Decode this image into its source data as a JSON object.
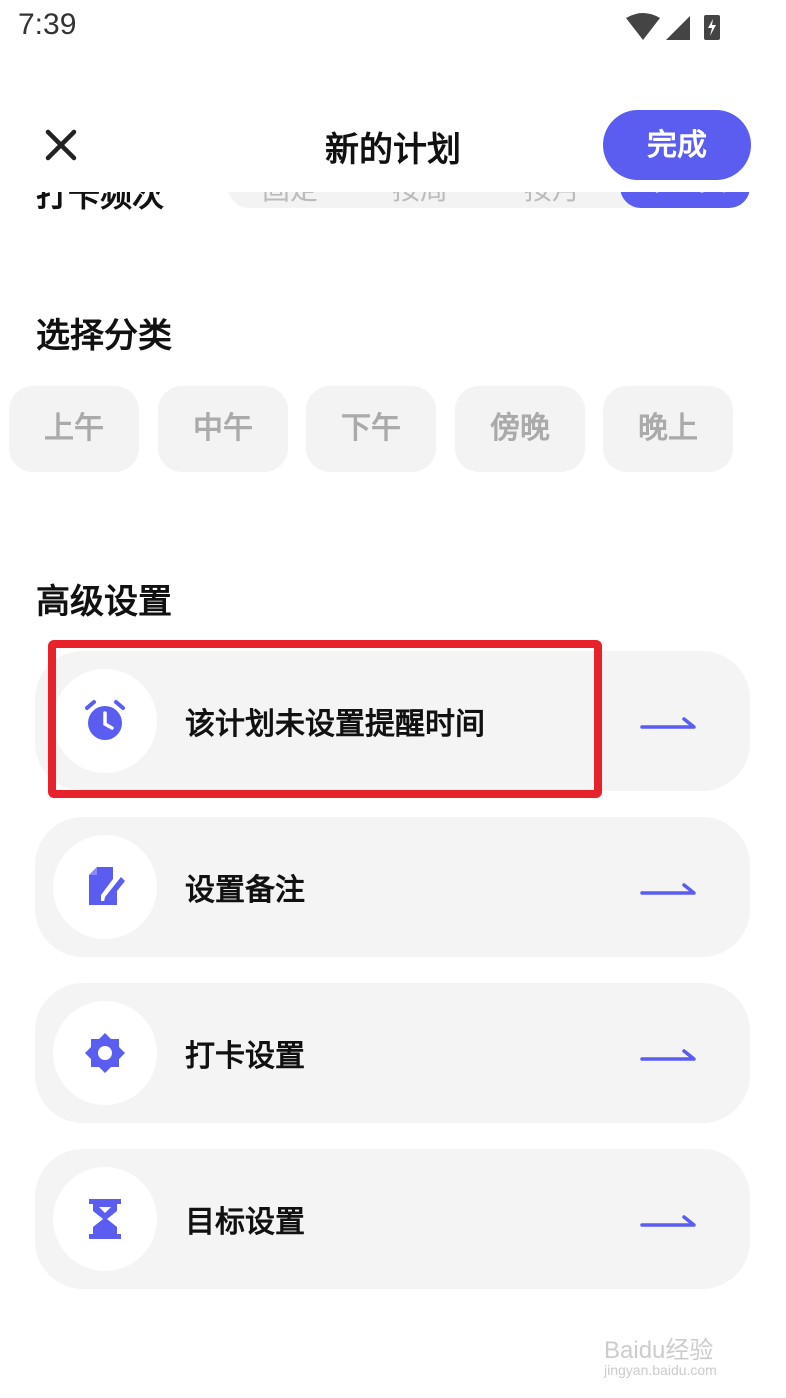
{
  "status_bar": {
    "time": "7:39"
  },
  "header": {
    "title": "新的计划",
    "done_label": "完成"
  },
  "frequency": {
    "label": "打卡频次",
    "options": [
      "固定",
      "按周",
      "按月",
      "不重复"
    ]
  },
  "category": {
    "title": "选择分类",
    "chips": [
      "上午",
      "中午",
      "下午",
      "傍晚",
      "晚上"
    ]
  },
  "advanced": {
    "title": "高级设置",
    "items": [
      {
        "label": "该计划未设置提醒时间",
        "icon": "alarm-clock-icon"
      },
      {
        "label": "设置备注",
        "icon": "edit-note-icon"
      },
      {
        "label": "打卡设置",
        "icon": "gear-icon"
      },
      {
        "label": "目标设置",
        "icon": "hourglass-icon"
      }
    ]
  },
  "watermark": {
    "brand": "Baidu经验",
    "url": "jingyan.baidu.com"
  },
  "colors": {
    "accent": "#5b5cf0",
    "highlight": "#e8222a",
    "card_bg": "#f4f4f4"
  }
}
